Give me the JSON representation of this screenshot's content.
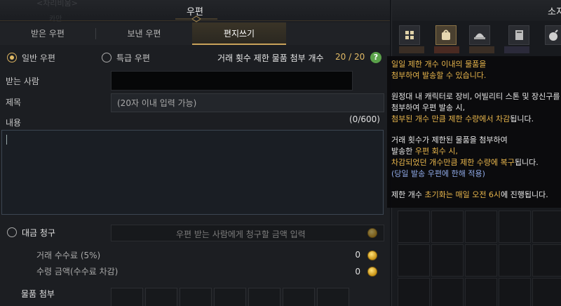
{
  "mail": {
    "title": "우편",
    "bg_name": "<차리비움>",
    "bg_name2": "카만",
    "tabs": [
      {
        "label": "받은 우편",
        "active": false
      },
      {
        "label": "보낸 우편",
        "active": false
      },
      {
        "label": "편지쓰기",
        "active": true
      }
    ],
    "mail_types": [
      {
        "label": "일반 우편",
        "selected": true
      },
      {
        "label": "특급 우편",
        "selected": false
      }
    ],
    "trade_limit": {
      "label": "거래 횟수 제한 물품 첨부 개수",
      "value": "20 / 20",
      "help_icon": "question-icon"
    },
    "recipient": {
      "label": "받는 사람",
      "value": ""
    },
    "subject": {
      "label": "제목",
      "placeholder": "(20자 이내 입력 가능)"
    },
    "content": {
      "label": "내용",
      "counter": "(0/600)",
      "value": ""
    },
    "billing": {
      "label": "대금 청구",
      "selected": false,
      "placeholder": "우편 받는 사람에게 청구할 금액 입력",
      "fee_label": "거래 수수료 (5%)",
      "fee_value": "0",
      "receive_label": "수령 금액(수수료 차감)",
      "receive_value": "0"
    },
    "attachments": {
      "label": "물품 첨부",
      "slot_count": 7
    }
  },
  "bag": {
    "title": "소지",
    "tab_icons": [
      "grid-icon",
      "bag-icon",
      "hat-icon",
      "book-icon",
      "bomb-icon"
    ]
  },
  "tooltip": {
    "l1a": "일일 제한 개수 이내의 물품을",
    "l1b": "첨부하여 발송할 수 있습니다.",
    "l2a": "원정대 내 캐릭터로 장비, 어빌리티 스톤 및 장신구를",
    "l2b": "첨부하여 우편 발송 시,",
    "l2c_hl": "첨부된 개수 만큼 제한 수량에서 차감",
    "l2c_rest": "됩니다.",
    "l3a": "거래 횟수가 제한된 물품을 첨부하여",
    "l3b_pre": "발송한 ",
    "l3b_hl": "우편 회수 시,",
    "l3c_hl": "차감되었던 개수만큼 제한 수량에 복구",
    "l3c_rest": "됩니다.",
    "l3d": "(당일 발송 우편에 한해 적용)",
    "l4_pre": "제한 개수 ",
    "l4_hl": "초기화는 매일 오전 6시",
    "l4_rest": "에 진행됩니다."
  },
  "colors": {
    "accent_gold": "#e2bb66",
    "highlight_yellow": "#e8b64c",
    "info_blue": "#8fa9e6"
  }
}
